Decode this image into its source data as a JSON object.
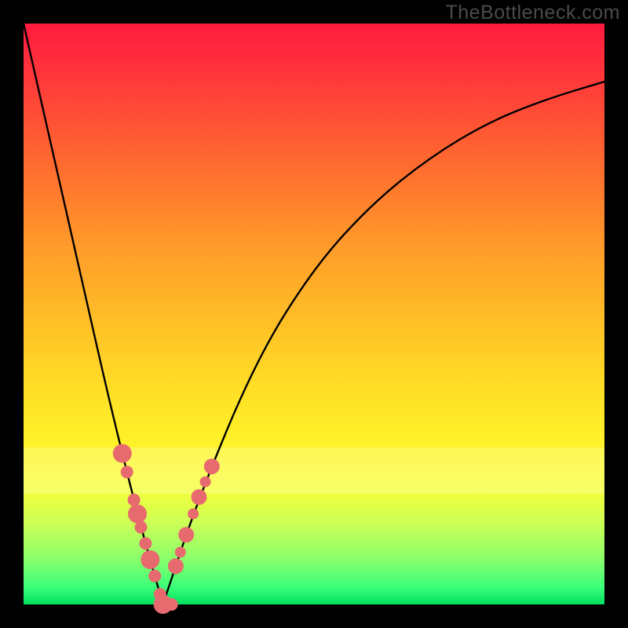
{
  "watermark": "TheBottleneck.com",
  "chart_data": {
    "type": "line",
    "title": "",
    "xlabel": "",
    "ylabel": "",
    "xlim": [
      0,
      100
    ],
    "ylim": [
      0,
      100
    ],
    "x_optimum": 24,
    "left_curve": {
      "x": [
        0,
        5,
        10,
        15,
        20,
        24
      ],
      "y": [
        100,
        78,
        56,
        34,
        14,
        0
      ]
    },
    "right_curve": {
      "x": [
        24,
        30,
        40,
        50,
        60,
        70,
        80,
        90,
        100
      ],
      "y": [
        0,
        18,
        42,
        58,
        69,
        77,
        83,
        87,
        90
      ]
    },
    "markers": {
      "left_branch_x": [
        17.0,
        17.8,
        19.0,
        19.6,
        20.2,
        21.0,
        21.8,
        22.6,
        23.5,
        24.0,
        24.7,
        25.5
      ],
      "right_branch_x": [
        26.2,
        27.0,
        28.0,
        29.2,
        30.2,
        31.3,
        32.4
      ]
    },
    "lighten_band_y": [
      19,
      27
    ],
    "marker_color": "#e76a6f"
  }
}
